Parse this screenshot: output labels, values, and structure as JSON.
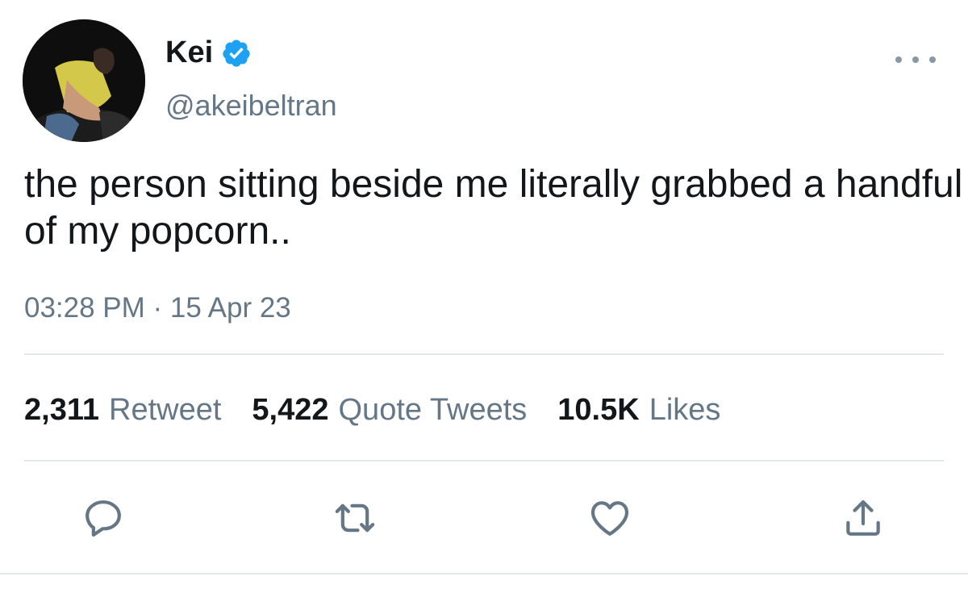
{
  "author": {
    "display_name": "Kei",
    "handle": "@akeibeltran",
    "verified": true
  },
  "tweet": {
    "text": "the person sitting beside me literally grabbed a handful of my popcorn..",
    "timestamp": "03:28 PM · 15 Apr 23"
  },
  "stats": {
    "retweets": {
      "count": "2,311",
      "label": "Retweet"
    },
    "quotes": {
      "count": "5,422",
      "label": "Quote Tweets"
    },
    "likes": {
      "count": "10.5K",
      "label": "Likes"
    }
  },
  "icons": {
    "verified": "verified-badge-icon",
    "more": "more-icon",
    "reply": "reply-icon",
    "retweet": "retweet-icon",
    "like": "heart-icon",
    "share": "share-icon"
  },
  "colors": {
    "text_primary": "#14171a",
    "text_secondary": "#657786",
    "verified_blue": "#1da1f2",
    "icon_gray": "#657786",
    "divider": "#e1e8ed"
  }
}
